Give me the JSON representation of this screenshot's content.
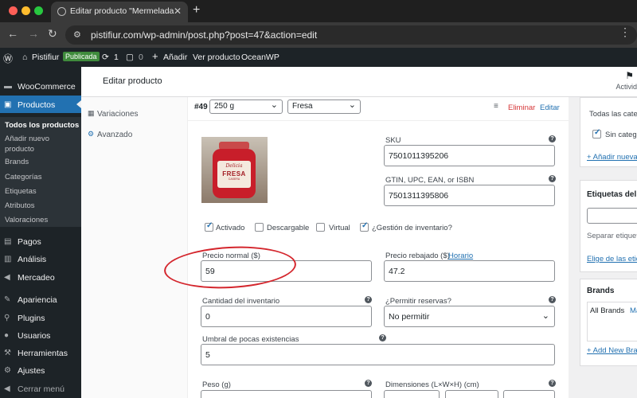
{
  "browser": {
    "tab_title": "Editar producto \"Mermelada",
    "url": "pistifiur.com/wp-admin/post.php?post=47&action=edit"
  },
  "adminbar": {
    "site_name": "Pistifiur",
    "badge": "Publicada",
    "updates_count": "1",
    "comments_count": "0",
    "add_label": "Añadir",
    "view_label": "Ver producto",
    "theme_label": "OceanWP"
  },
  "sidebar": {
    "items": [
      {
        "label": "WooCommerce",
        "icon": "woo-icon"
      },
      {
        "label": "Productos",
        "icon": "box-icon"
      },
      {
        "label": "Pagos",
        "icon": "payments-icon"
      },
      {
        "label": "Análisis",
        "icon": "analytics-icon"
      },
      {
        "label": "Mercadeo",
        "icon": "megaphone-icon"
      },
      {
        "label": "Apariencia",
        "icon": "brush-icon"
      },
      {
        "label": "Plugins",
        "icon": "plug-icon"
      },
      {
        "label": "Usuarios",
        "icon": "user-icon"
      },
      {
        "label": "Herramientas",
        "icon": "wrench-icon"
      },
      {
        "label": "Ajustes",
        "icon": "settings-icon"
      },
      {
        "label": "Cerrar menú",
        "icon": "collapse-icon"
      }
    ],
    "sub_items": [
      "Todos los productos",
      "Añadir nuevo producto",
      "Brands",
      "Categorías",
      "Etiquetas",
      "Atributos",
      "Valoraciones"
    ]
  },
  "header": {
    "title": "Editar producto",
    "activity": "Activid"
  },
  "inner_tabs": [
    "Variaciones",
    "Avanzado"
  ],
  "variation": {
    "number": "#49",
    "size": "250 g",
    "flavor": "Fresa",
    "remove": "Eliminar",
    "edit": "Editar",
    "sku_label": "SKU",
    "sku_value": "7501011395206",
    "gtin_label": "GTIN, UPC, EAN, or ISBN",
    "gtin_value": "7501311395806",
    "checkboxes": [
      {
        "label": "Activado",
        "checked": true
      },
      {
        "label": "Descargable",
        "checked": false
      },
      {
        "label": "Virtual",
        "checked": false
      },
      {
        "label": "¿Gestión de inventario?",
        "checked": true
      }
    ],
    "regular_price_label": "Precio normal ($)",
    "regular_price_value": "59",
    "sale_price_label": "Precio rebajado ($)",
    "schedule_link": "Horario",
    "sale_price_value": "47.2",
    "stock_qty_label": "Cantidad del inventario",
    "stock_qty_value": "0",
    "backorders_label": "¿Permitir reservas?",
    "backorders_value": "No permitir",
    "low_stock_label": "Umbral de pocas existencias",
    "low_stock_value": "5",
    "weight_label": "Peso (g)",
    "dimensions_label": "Dimensiones (L×W×H) (cm)",
    "jar": {
      "brand": "Delicia",
      "name": "FRESA",
      "sub": "CASERA"
    }
  },
  "right": {
    "categories_all": "Todas las categ",
    "category_item": "Sin categ",
    "add_category": "+ Añadir nueva",
    "tags_title": "Etiquetas del p",
    "tags_sep": "Separar etiqueta",
    "tags_choose": "Elige de las etiq",
    "brands_title": "Brands",
    "brands_all": "All Brands",
    "brands_more": "Má",
    "add_brand": "+ Add New Bran"
  },
  "colors": {
    "accent": "#2271b1",
    "admin_dark": "#1d2327",
    "danger": "#d63638",
    "annotation": "#d4262d"
  }
}
